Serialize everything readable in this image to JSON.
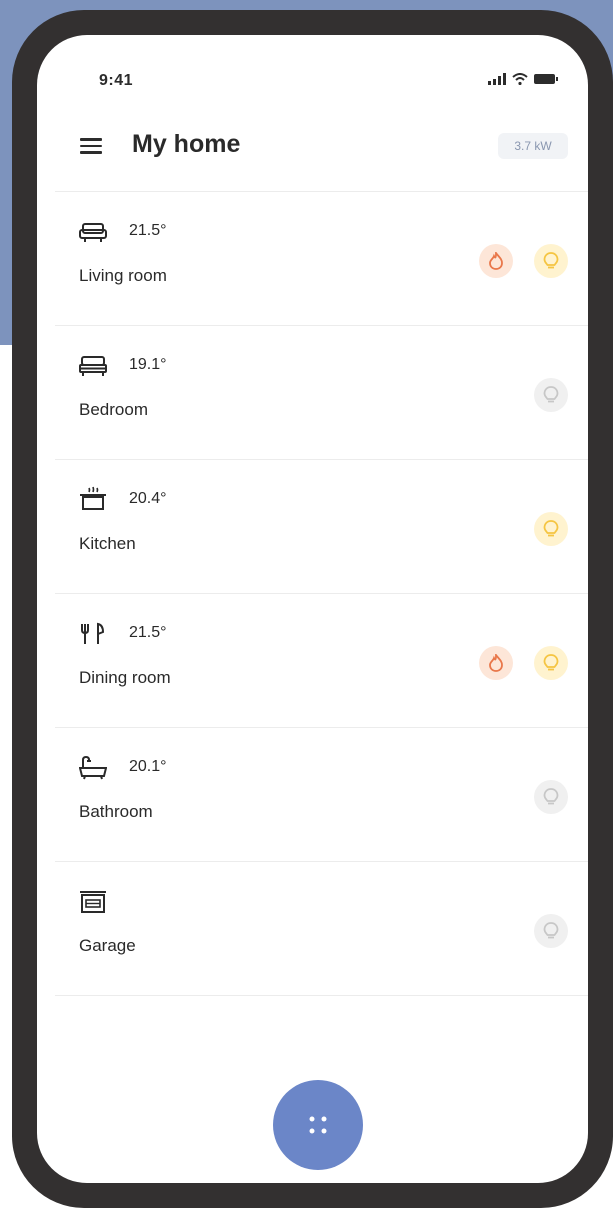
{
  "status_bar": {
    "time": "9:41"
  },
  "header": {
    "title": "My home",
    "power": "3.7 kW"
  },
  "rooms": [
    {
      "name": "Living room",
      "temp": "21.5°",
      "icon": "sofa-icon",
      "heating": true,
      "light": true
    },
    {
      "name": "Bedroom",
      "temp": "19.1°",
      "icon": "bed-icon",
      "heating": false,
      "light": false
    },
    {
      "name": "Kitchen",
      "temp": "20.4°",
      "icon": "pot-icon",
      "heating": false,
      "light": true
    },
    {
      "name": "Dining room",
      "temp": "21.5°",
      "icon": "fork-knife-icon",
      "heating": true,
      "light": true
    },
    {
      "name": "Bathroom",
      "temp": "20.1°",
      "icon": "bathtub-icon",
      "heating": false,
      "light": false
    },
    {
      "name": "Garage",
      "temp": "",
      "icon": "garage-icon",
      "heating": false,
      "light": false
    }
  ],
  "colors": {
    "accent": "#6b86c8",
    "heat": "#e9774a",
    "light_on": "#f5c542",
    "light_off": "#c7c7c7",
    "frame": "#333030",
    "backdrop": "#7d93bd"
  },
  "fab": {
    "icon": "grid-dots-icon"
  }
}
